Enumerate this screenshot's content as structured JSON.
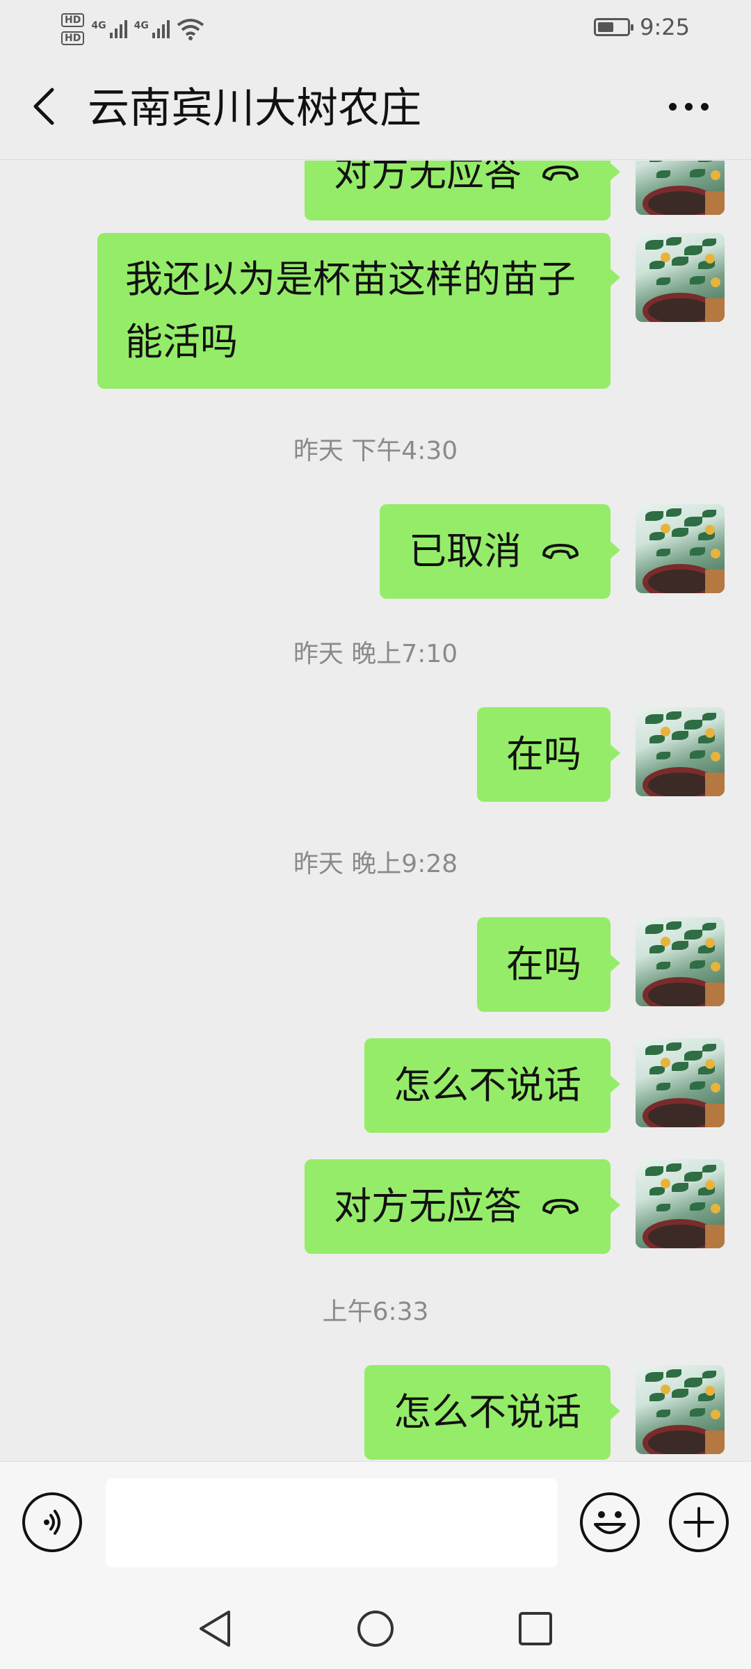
{
  "status_bar": {
    "hd_1": "HD",
    "hd_2": "HD",
    "net_1": "4G",
    "net_2": "4G",
    "battery_level": 0.55,
    "time": "9:25"
  },
  "header": {
    "title": "云南宾川大树农庄"
  },
  "messages": [
    {
      "side": "right",
      "text": "对方无应答",
      "icon": "phone-hangup-icon",
      "partial": true
    },
    {
      "side": "right",
      "text": "我还以为是杯苗这样的苗子能活吗"
    },
    {
      "type": "time",
      "text": "昨天 下午4:30"
    },
    {
      "side": "right",
      "text": "已取消",
      "icon": "phone-hangup-icon"
    },
    {
      "type": "time",
      "text": "昨天 晚上7:10"
    },
    {
      "side": "right",
      "text": "在吗"
    },
    {
      "type": "time",
      "text": "昨天 晚上9:28"
    },
    {
      "side": "right",
      "text": "在吗"
    },
    {
      "side": "right",
      "text": "怎么不说话"
    },
    {
      "side": "right",
      "text": "对方无应答",
      "icon": "phone-hangup-icon"
    },
    {
      "type": "time",
      "text": "上午6:33"
    },
    {
      "side": "right",
      "text": "怎么不说话"
    }
  ],
  "input_bar": {
    "placeholder": "",
    "value": ""
  },
  "icons": {
    "back": "chevron-left-icon",
    "more": "more-dots-icon",
    "voice": "voice-icon",
    "emoji": "emoji-icon",
    "plus": "plus-icon",
    "call": "phone-hangup-icon",
    "nav_back": "triangle-back-icon",
    "nav_home": "circle-home-icon",
    "nav_recent": "square-recents-icon"
  },
  "colors": {
    "bubble": "#95ec69",
    "background": "#ededed",
    "timestamp": "#8a8a8a"
  }
}
